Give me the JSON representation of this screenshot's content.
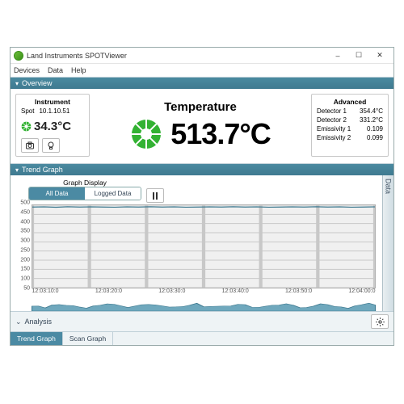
{
  "window": {
    "title": "Land Instruments SPOTViewer"
  },
  "menu": {
    "devices": "Devices",
    "data": "Data",
    "help": "Help"
  },
  "window_controls": {
    "min": "–",
    "max": "☐",
    "close": "✕"
  },
  "overview": {
    "header": "Overview",
    "instrument": {
      "header": "Instrument",
      "spot_label": "Spot",
      "spot_ip": "10.1.10.51",
      "spot_value": "34.3°C"
    },
    "main": {
      "label": "Temperature",
      "value": "513.7°C"
    },
    "advanced": {
      "header": "Advanced",
      "rows": [
        {
          "k": "Detector 1",
          "v": "354.4°C"
        },
        {
          "k": "Detector 2",
          "v": "331.2°C"
        },
        {
          "k": "Emissivity 1",
          "v": "0.109"
        },
        {
          "k": "Emissivity 2",
          "v": "0.099"
        }
      ]
    }
  },
  "trend": {
    "header": "Trend Graph",
    "side_tab": "Data",
    "graph_display_label": "Graph Display",
    "seg_all": "All Data",
    "seg_logged": "Logged Data"
  },
  "analysis": {
    "label": "Analysis"
  },
  "tabs": {
    "trend": "Trend Graph",
    "scan": "Scan Graph"
  },
  "chart_data": {
    "type": "line",
    "title": "",
    "xlabel": "",
    "ylabel": "",
    "ylim": [
      50,
      500
    ],
    "y_ticks": [
      50,
      100,
      150,
      200,
      250,
      300,
      350,
      400,
      450,
      500
    ],
    "x_ticks": [
      "12:03:10:0",
      "12:03:20:0",
      "12:03:30:0",
      "12:03:40:0",
      "12:03:50:0",
      "12:04:00:0"
    ],
    "series": [
      {
        "name": "Temperature",
        "values": [
          490,
          491,
          489,
          492,
          490,
          491,
          490,
          489,
          491,
          490,
          492,
          490,
          491,
          489,
          490,
          491,
          490,
          492,
          490,
          491,
          489,
          490,
          491,
          490,
          492,
          490,
          491,
          489,
          490,
          491
        ]
      }
    ]
  }
}
